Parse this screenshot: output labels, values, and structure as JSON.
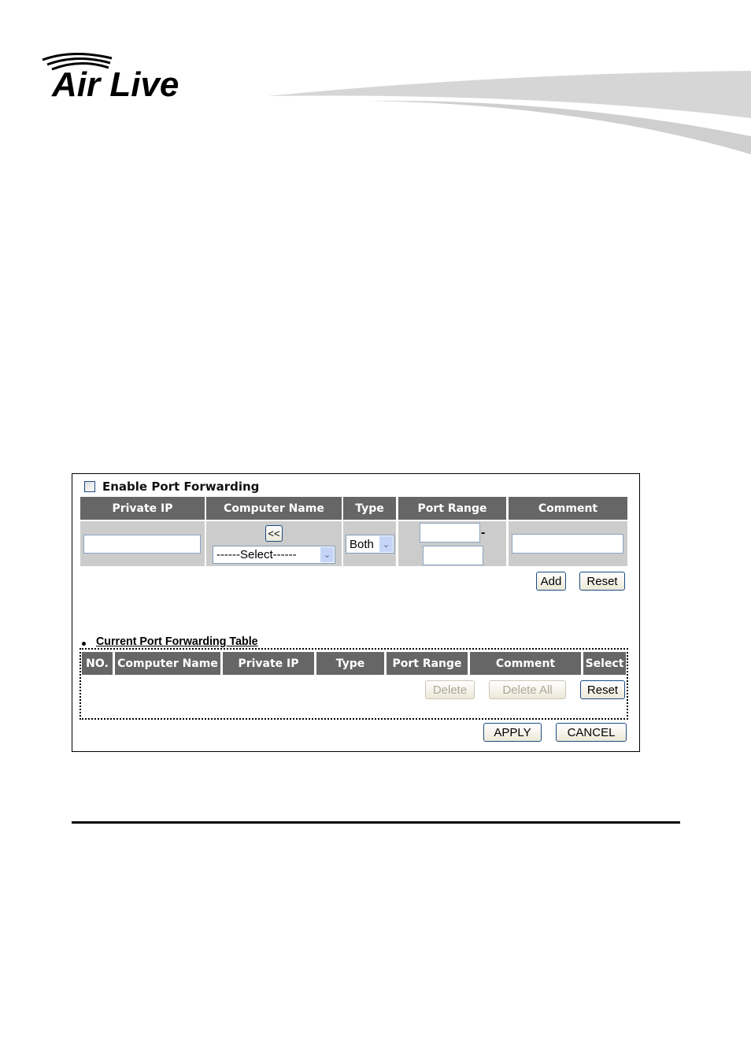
{
  "logo": {
    "text": "Air Live"
  },
  "form": {
    "enable_label": "Enable Port Forwarding",
    "enable_checked": false,
    "columns": [
      "Private IP",
      "Computer Name",
      "Type",
      "Port Range",
      "Comment"
    ],
    "copy_button": "<<",
    "computer_select": "------Select------",
    "type_select": "Both",
    "range_dash": "-",
    "private_ip": "",
    "port_start": "",
    "port_end": "",
    "comment": "",
    "add_button": "Add",
    "reset_button": "Reset"
  },
  "table": {
    "title": "Current Port Forwarding Table",
    "columns": [
      "NO.",
      "Computer Name",
      "Private IP",
      "Type",
      "Port Range",
      "Comment",
      "Select"
    ],
    "delete_button": "Delete",
    "delete_all_button": "Delete All",
    "reset_button": "Reset"
  },
  "apply_button": "APPLY",
  "cancel_button": "CANCEL",
  "colors": {
    "header_bg": "#666666",
    "input_row_bg": "#cccccc",
    "button_border": "#1c4b86"
  }
}
